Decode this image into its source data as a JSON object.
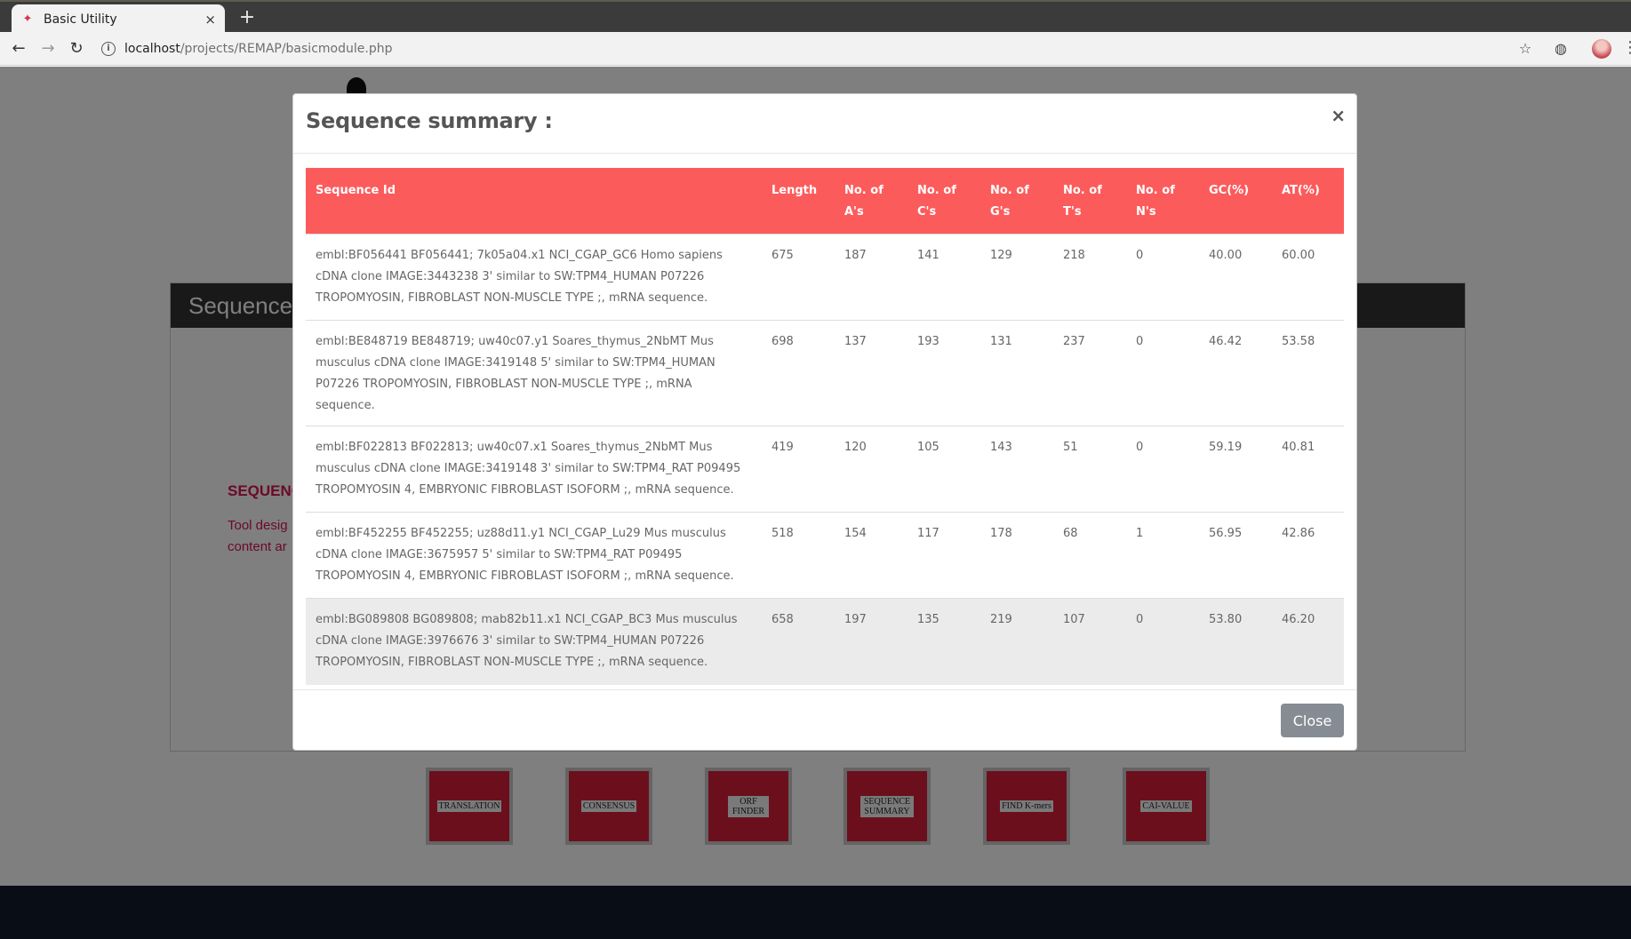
{
  "browser": {
    "tab_title": "Basic Utility",
    "tab_close": "×",
    "new_tab": "+",
    "url_host": "localhost",
    "url_path": "/projects/REMAP/basicmodule.php"
  },
  "background": {
    "panel_title": "Sequence",
    "heading": "SEQUENC",
    "text_line1": "Tool desig",
    "text_line2": "content ar",
    "tools": [
      "TRANSLATION",
      "CONSENSUS",
      "ORF FINDER",
      "SEQUENCE SUMMARY",
      "FIND K-mers",
      "CAI-VALUE"
    ]
  },
  "modal": {
    "title": "Sequence summary :",
    "close_x": "×",
    "close_button": "Close",
    "columns": [
      "Sequence Id",
      "Length",
      "No. of A's",
      "No. of C's",
      "No. of G's",
      "No. of T's",
      "No. of N's",
      "GC(%)",
      "AT(%)"
    ],
    "rows": [
      {
        "id": "embl:BF056441 BF056441; 7k05a04.x1 NCI_CGAP_GC6 Homo sapiens cDNA clone IMAGE:3443238 3' similar to SW:TPM4_HUMAN P07226 TROPOMYOSIN, FIBROBLAST NON-MUSCLE TYPE ;, mRNA sequence.",
        "length": "675",
        "a": "187",
        "c": "141",
        "g": "129",
        "t": "218",
        "n": "0",
        "gc": "40.00",
        "at": "60.00"
      },
      {
        "id": "embl:BE848719 BE848719; uw40c07.y1 Soares_thymus_2NbMT Mus musculus cDNA clone IMAGE:3419148 5' similar to SW:TPM4_HUMAN P07226 TROPOMYOSIN, FIBROBLAST NON-MUSCLE TYPE ;, mRNA sequence.",
        "length": "698",
        "a": "137",
        "c": "193",
        "g": "131",
        "t": "237",
        "n": "0",
        "gc": "46.42",
        "at": "53.58"
      },
      {
        "id": "embl:BF022813 BF022813; uw40c07.x1 Soares_thymus_2NbMT Mus musculus cDNA clone IMAGE:3419148 3' similar to SW:TPM4_RAT P09495 TROPOMYOSIN 4, EMBRYONIC FIBROBLAST ISOFORM ;, mRNA sequence.",
        "length": "419",
        "a": "120",
        "c": "105",
        "g": "143",
        "t": "51",
        "n": "0",
        "gc": "59.19",
        "at": "40.81"
      },
      {
        "id": "embl:BF452255 BF452255; uz88d11.y1 NCI_CGAP_Lu29 Mus musculus cDNA clone IMAGE:3675957 5' similar to SW:TPM4_RAT P09495 TROPOMYOSIN 4, EMBRYONIC FIBROBLAST ISOFORM ;, mRNA sequence.",
        "length": "518",
        "a": "154",
        "c": "117",
        "g": "178",
        "t": "68",
        "n": "1",
        "gc": "56.95",
        "at": "42.86"
      },
      {
        "id": "embl:BG089808 BG089808; mab82b11.x1 NCI_CGAP_BC3 Mus musculus cDNA clone IMAGE:3976676 3' similar to SW:TPM4_HUMAN P07226 TROPOMYOSIN, FIBROBLAST NON-MUSCLE TYPE ;, mRNA sequence.",
        "length": "658",
        "a": "197",
        "c": "135",
        "g": "219",
        "t": "107",
        "n": "0",
        "gc": "53.80",
        "at": "46.20"
      }
    ]
  },
  "colors": {
    "table_header": "#fc5b5c",
    "tool_button": "#d91f3b",
    "close_button": "#858c94"
  }
}
